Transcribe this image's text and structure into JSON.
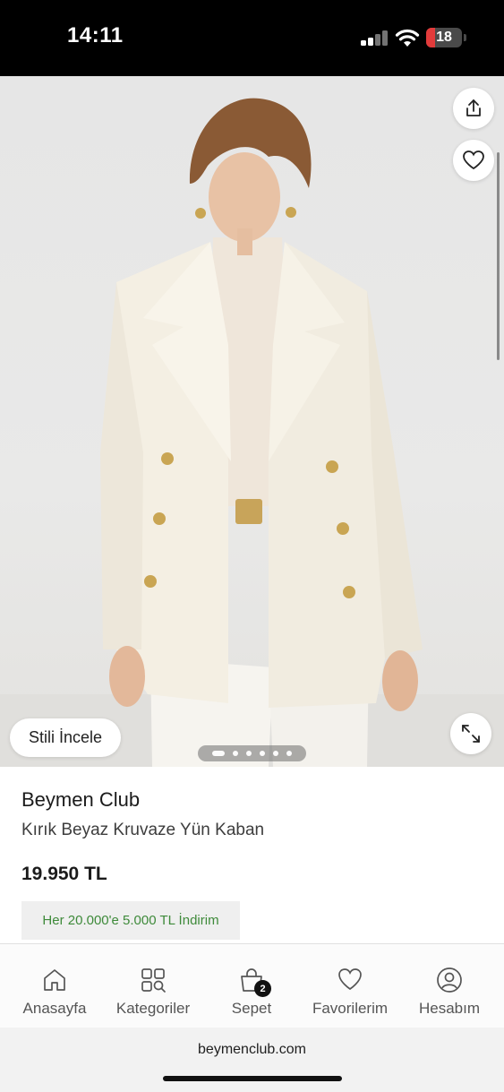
{
  "status_bar": {
    "time": "14:11",
    "battery": "18",
    "icons": [
      "signal-icon",
      "wifi-icon",
      "battery-icon"
    ]
  },
  "gallery": {
    "image_description_icon": "product-photo",
    "style_button_label": "Stili İncele",
    "pager_count": 6,
    "pager_active_index": 0,
    "icons": [
      "share-icon",
      "heart-icon",
      "expand-icon"
    ]
  },
  "product": {
    "brand": "Beymen Club",
    "name": "Kırık Beyaz Kruvaze Yün Kaban",
    "price": "19.950 TL",
    "promo": "Her 20.000'e 5.000 TL İndirim"
  },
  "bottom_nav": {
    "items": [
      {
        "label": "Anasayfa",
        "icon": "home-icon"
      },
      {
        "label": "Kategoriler",
        "icon": "categories-icon"
      },
      {
        "label": "Sepet",
        "icon": "cart-icon",
        "badge": "2"
      },
      {
        "label": "Favorilerim",
        "icon": "heart-icon"
      },
      {
        "label": "Hesabım",
        "icon": "account-icon"
      }
    ]
  },
  "browser": {
    "url": "beymenclub.com"
  },
  "colors": {
    "promo_text": "#3e8a3a",
    "promo_bg": "#efefef",
    "battery_low": "#e23b3b"
  }
}
